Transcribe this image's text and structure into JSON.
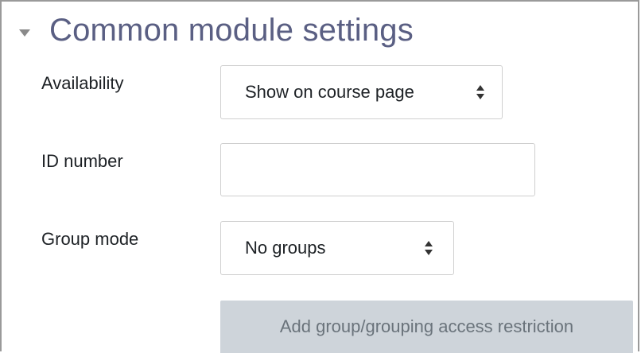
{
  "section": {
    "title": "Common module settings",
    "toggle_icon": "triangle-down-icon"
  },
  "fields": {
    "availability": {
      "label": "Availability",
      "value": "Show on course page"
    },
    "id_number": {
      "label": "ID number",
      "value": ""
    },
    "group_mode": {
      "label": "Group mode",
      "value": "No groups"
    }
  },
  "buttons": {
    "add_restriction": "Add group/grouping access restriction"
  },
  "colors": {
    "section_title": "#5a5f83",
    "button_bg": "#ced4da",
    "button_text": "#6a737b",
    "border": "#cfcfcf"
  }
}
